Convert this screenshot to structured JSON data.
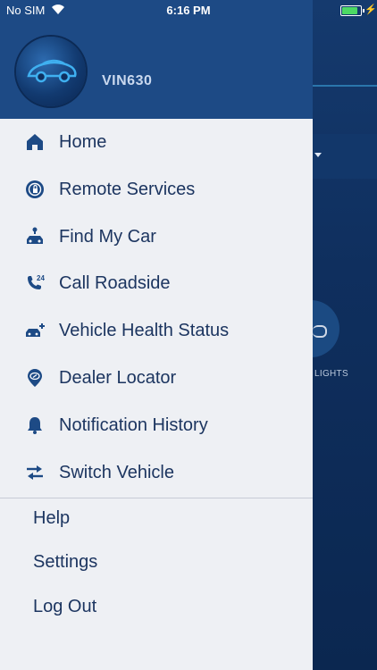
{
  "status_bar": {
    "carrier": "No SIM",
    "time": "6:16 PM",
    "battery_level": 0.95
  },
  "background": {
    "lights_label": "LIGHTS"
  },
  "drawer": {
    "vehicle_name": "VIN630",
    "items": [
      {
        "label": "Home",
        "icon": "home-icon"
      },
      {
        "label": "Remote Services",
        "icon": "remote-services-icon"
      },
      {
        "label": "Find My Car",
        "icon": "find-my-car-icon"
      },
      {
        "label": "Call Roadside",
        "icon": "roadside-24-icon"
      },
      {
        "label": "Vehicle Health Status",
        "icon": "vehicle-health-icon"
      },
      {
        "label": "Dealer Locator",
        "icon": "dealer-locator-icon"
      },
      {
        "label": "Notification History",
        "icon": "bell-icon"
      },
      {
        "label": "Switch Vehicle",
        "icon": "switch-arrows-icon"
      }
    ],
    "secondary": [
      {
        "label": "Help"
      },
      {
        "label": "Settings"
      },
      {
        "label": "Log Out"
      }
    ]
  },
  "colors": {
    "header": "#1d4a85",
    "text": "#1c3560",
    "drawer_bg": "#eef0f4"
  }
}
